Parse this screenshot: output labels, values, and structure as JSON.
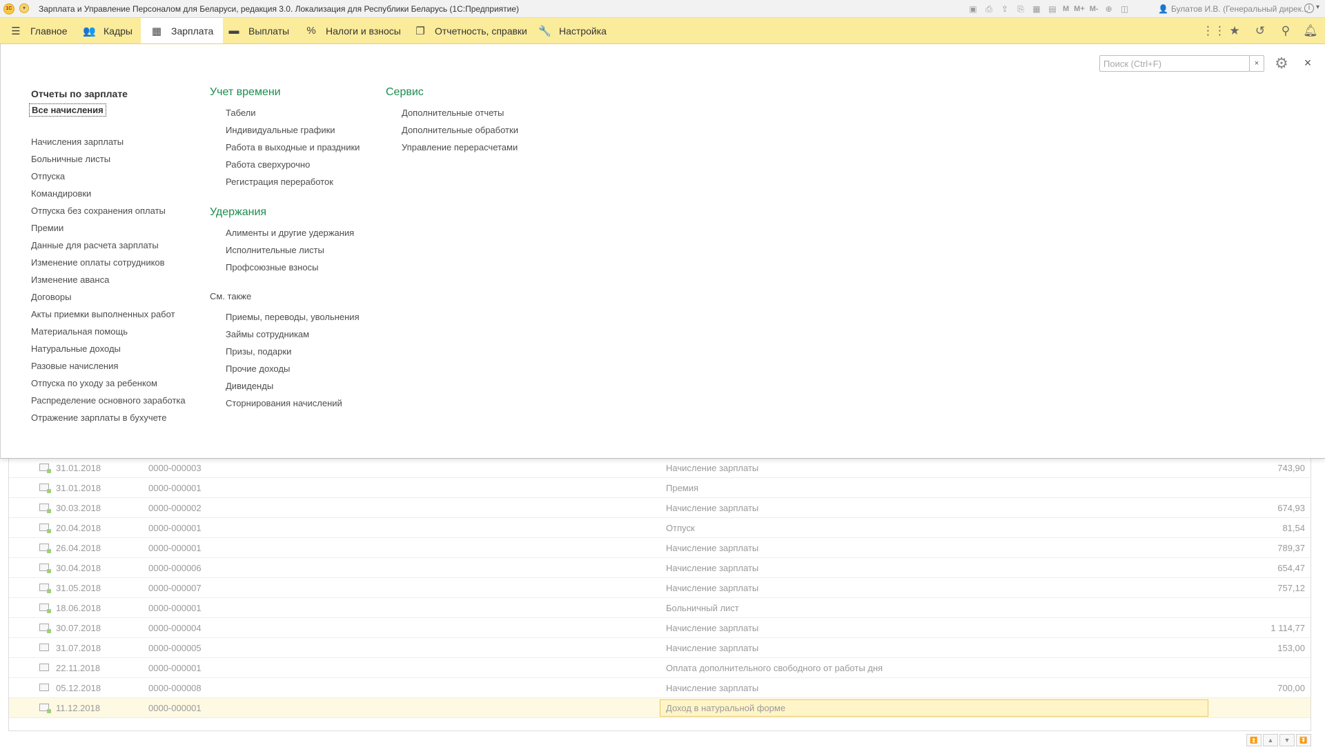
{
  "app": {
    "title": "Зарплата и Управление Персоналом для Беларуси, редакция 3.0. Локализация для Республики Беларусь  (1С:Предприятие)",
    "logo": "1С",
    "user": "Булатов И.В. (Генеральный дирек...",
    "toolbar_text": {
      "m": "M",
      "m_plus": "M+",
      "m_minus": "M-"
    }
  },
  "sections": [
    {
      "label": "Главное",
      "icon": "hamburger-icon"
    },
    {
      "label": "Кадры",
      "icon": "people-icon"
    },
    {
      "label": "Зарплата",
      "icon": "calculator-icon",
      "active": true
    },
    {
      "label": "Выплаты",
      "icon": "card-icon"
    },
    {
      "label": "Налоги и взносы",
      "icon": "percent-icon"
    },
    {
      "label": "Отчетность, справки",
      "icon": "reports-icon"
    },
    {
      "label": "Настройка",
      "icon": "wrench-icon"
    }
  ],
  "panel": {
    "search_placeholder": "Поиск (Ctrl+F)",
    "search_value": "",
    "clear_label": "×",
    "close_label": "×",
    "col1": {
      "heading": "Отчеты по зарплате",
      "focused_link": "Все начисления",
      "links": [
        "Начисления зарплаты",
        "Больничные листы",
        "Отпуска",
        "Командировки",
        "Отпуска без сохранения оплаты",
        "Премии",
        "Данные для расчета зарплаты",
        "Изменение оплаты сотрудников",
        "Изменение аванса",
        "Договоры",
        "Акты приемки выполненных работ",
        "Материальная помощь",
        "Натуральные доходы",
        "Разовые начисления",
        "Отпуска по уходу за ребенком",
        "Распределение основного заработка",
        "Отражение зарплаты в бухучете"
      ]
    },
    "col2": {
      "time_heading": "Учет времени",
      "time_links": [
        "Табели",
        "Индивидуальные графики",
        "Работа в выходные и праздники",
        "Работа сверхурочно",
        "Регистрация переработок"
      ],
      "deduct_heading": "Удержания",
      "deduct_links": [
        "Алименты и другие удержания",
        "Исполнительные листы",
        "Профсоюзные взносы"
      ],
      "see_also_heading": "См. также",
      "see_also_links": [
        "Приемы, переводы, увольнения",
        "Займы сотрудникам",
        "Призы, подарки",
        "Прочие доходы",
        "Дивиденды",
        "Сторнирования начислений"
      ]
    },
    "col3": {
      "heading": "Сервис",
      "links": [
        "Дополнительные отчеты",
        "Дополнительные обработки",
        "Управление перерасчетами"
      ]
    }
  },
  "list": {
    "rows": [
      {
        "date": "31.01.2018",
        "number": "0000-000003",
        "kind": "Начисление зарплаты",
        "sum": "743,90",
        "posted": true
      },
      {
        "date": "31.01.2018",
        "number": "0000-000001",
        "kind": "Премия",
        "sum": "",
        "posted": true
      },
      {
        "date": "30.03.2018",
        "number": "0000-000002",
        "kind": "Начисление зарплаты",
        "sum": "674,93",
        "posted": true
      },
      {
        "date": "20.04.2018",
        "number": "0000-000001",
        "kind": "Отпуск",
        "sum": "81,54",
        "posted": true
      },
      {
        "date": "26.04.2018",
        "number": "0000-000001",
        "kind": "Начисление зарплаты",
        "sum": "789,37",
        "posted": true
      },
      {
        "date": "30.04.2018",
        "number": "0000-000006",
        "kind": "Начисление зарплаты",
        "sum": "654,47",
        "posted": true
      },
      {
        "date": "31.05.2018",
        "number": "0000-000007",
        "kind": "Начисление зарплаты",
        "sum": "757,12",
        "posted": true
      },
      {
        "date": "18.06.2018",
        "number": "0000-000001",
        "kind": "Больничный лист",
        "sum": "",
        "posted": true
      },
      {
        "date": "30.07.2018",
        "number": "0000-000004",
        "kind": "Начисление зарплаты",
        "sum": "1 114,77",
        "posted": true
      },
      {
        "date": "31.07.2018",
        "number": "0000-000005",
        "kind": "Начисление зарплаты",
        "sum": "153,00",
        "posted": false
      },
      {
        "date": "22.11.2018",
        "number": "0000-000001",
        "kind": "Оплата дополнительного свободного от работы дня",
        "sum": "",
        "posted": false
      },
      {
        "date": "05.12.2018",
        "number": "0000-000008",
        "kind": "Начисление зарплаты",
        "sum": "700,00",
        "posted": false
      },
      {
        "date": "11.12.2018",
        "number": "0000-000001",
        "kind": "Доход в натуральной форме",
        "sum": "",
        "posted": true,
        "selected": true
      }
    ]
  }
}
